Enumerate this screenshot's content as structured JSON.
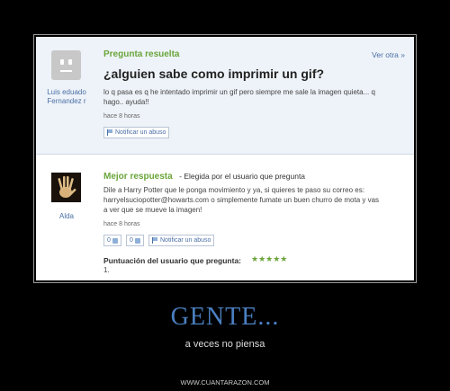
{
  "question": {
    "header_label": "Pregunta resuelta",
    "other_link": "Ver otra »",
    "title": "¿alguien sabe como imprimir un gif?",
    "body_lines": [
      "lo q pasa es q he intentado imprimir un gif pero siempre me sale la imagen quieta... q",
      "hago.. ayuda!!"
    ],
    "time": "hace 8 horas",
    "report_label": "Notificar un abuso",
    "user_lines": [
      "Luis eduado",
      "Fernandez r"
    ]
  },
  "answer": {
    "header_label": "Mejor respuesta",
    "chosen_text": "- Elegida por el usuario que pregunta",
    "body_lines": [
      "Dile a Harry Potter que le ponga movimiento y ya, si quieres te paso su correo es:",
      "harryelsuciopotter@howarts.com o simplemente fumate un buen churro de mota y vas",
      "a ver que se mueve la imagen!"
    ],
    "time": "hace 8 horas",
    "thumbs_up": "0",
    "thumbs_down": "0",
    "report_label": "Notificar un abuso",
    "rating_label": "Puntuación del usuario que pregunta:",
    "rating_stars": "★★★★★",
    "rating_value": "1.",
    "user": "Alda"
  },
  "poster": {
    "headline": "GENTE...",
    "subline": "a veces no piensa",
    "site": "WWW.CUANTARAZON.COM"
  },
  "colors": {
    "accent_green": "#6aa53a",
    "link_blue": "#4a6fa5",
    "headline_blue": "#4a7fc0"
  }
}
